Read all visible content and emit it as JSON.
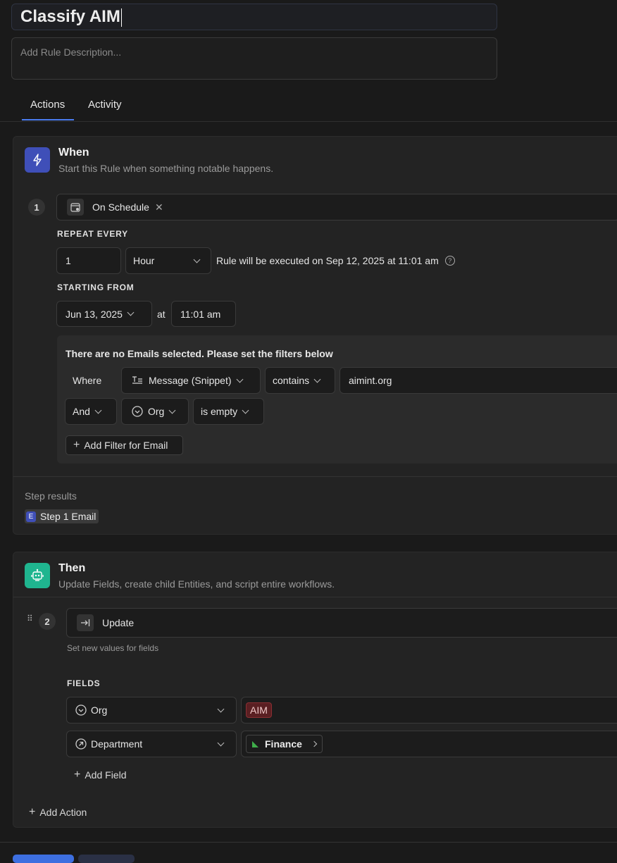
{
  "rule": {
    "title": "Classify AIM",
    "description_placeholder": "Add Rule Description..."
  },
  "tabs": [
    {
      "label": "Actions",
      "active": true
    },
    {
      "label": "Activity",
      "active": false
    }
  ],
  "colors": {
    "accent": "#4a7cf0",
    "when_icon": "#3f4fb8",
    "then_icon": "#1fb58f",
    "tag_aim": "#5a1f22"
  },
  "when": {
    "icon": "lightning-icon",
    "title": "When",
    "subtitle": "Start this Rule when something notable happens.",
    "step_number": "1",
    "trigger": {
      "icon": "calendar-icon",
      "label": "On Schedule",
      "remove_icon": "close-icon"
    },
    "repeat_label": "REPEAT EVERY",
    "repeat_value": "1",
    "repeat_unit": "Hour",
    "execution_note": "Rule will be executed on Sep 12, 2025 at 11:01 am",
    "starting_label": "STARTING FROM",
    "start_date": "Jun 13, 2025",
    "at_label": "at",
    "start_time": "11:01 am",
    "filters": {
      "notice": "There are no Emails selected. Please set the filters below",
      "row1": {
        "prefix": "Where",
        "field": "Message (Snippet)",
        "operator": "contains",
        "value": "aimint.org"
      },
      "row2": {
        "conjunction": "And",
        "field": "Org",
        "operator": "is empty"
      },
      "add_filter_label": "Add Filter for Email"
    },
    "step_results_label": "Step results",
    "step_result": {
      "badge": "E",
      "label": "Step 1 Email"
    }
  },
  "then": {
    "icon": "robot-icon",
    "title": "Then",
    "subtitle": "Update Fields, create child Entities, and script entire workflows.",
    "step_number": "2",
    "action": {
      "icon": "arrow-right-bar-icon",
      "label": "Update"
    },
    "action_sub": "Set new values for fields",
    "fields_label": "FIELDS",
    "fields": [
      {
        "icon": "circle-chevron-icon",
        "name": "Org",
        "value": "AIM"
      },
      {
        "icon": "circle-arrow-icon",
        "name": "Department",
        "value": "Finance"
      }
    ],
    "add_field_label": "Add Field",
    "add_action_label": "Add Action"
  }
}
